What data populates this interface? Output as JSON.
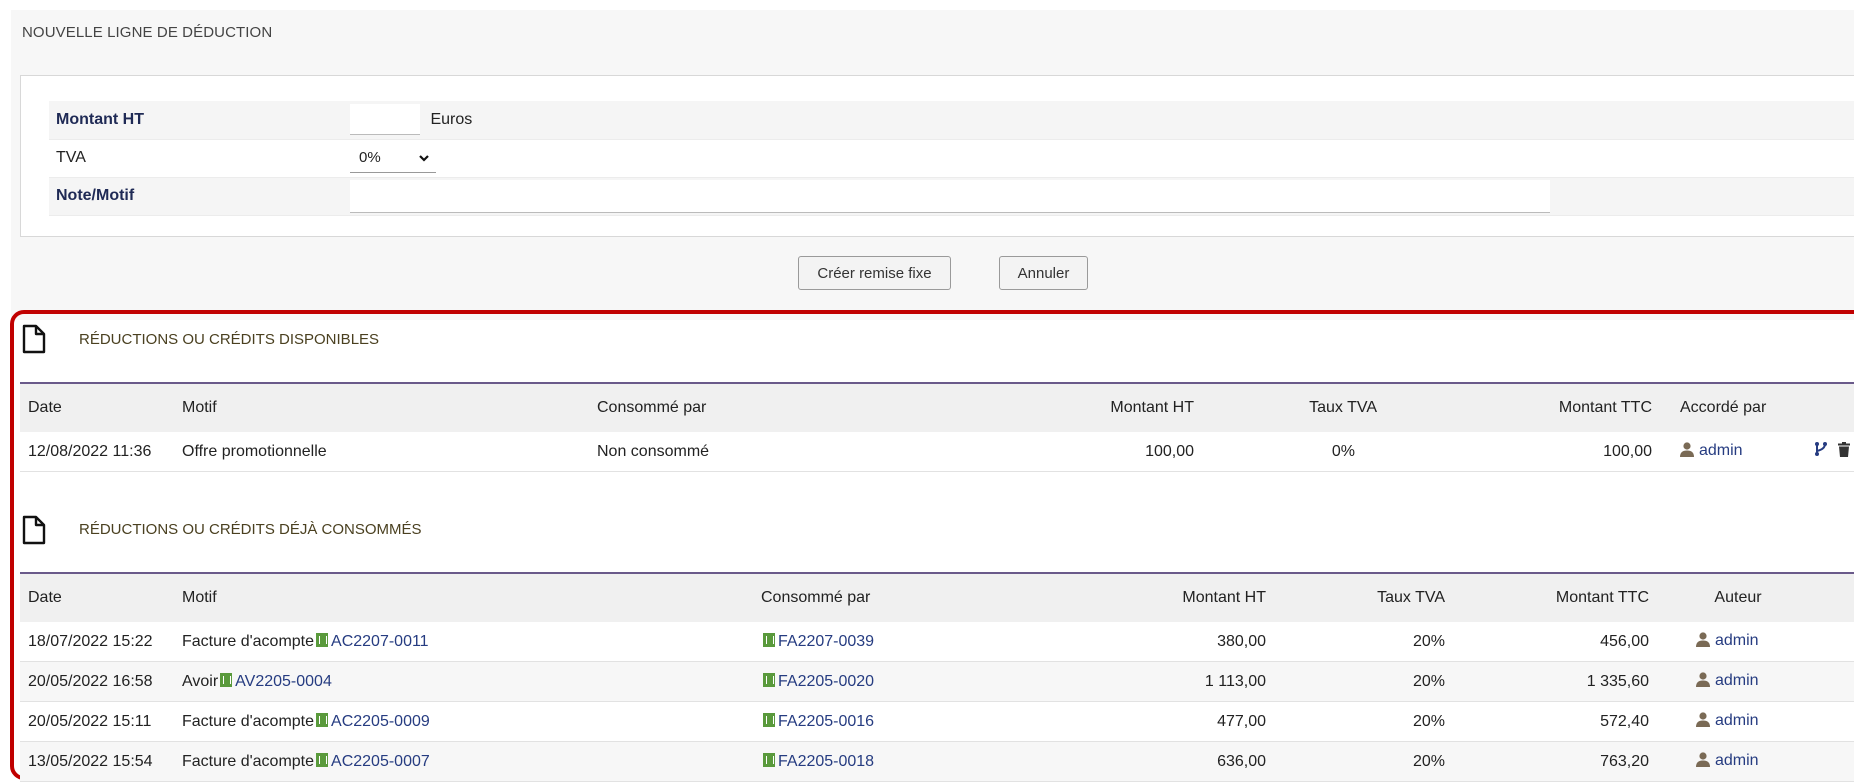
{
  "form": {
    "title": "NOUVELLE LIGNE DE DÉDUCTION",
    "montant_label": "Montant HT",
    "montant_value": "",
    "montant_unit": "Euros",
    "tva_label": "TVA",
    "tva_selected": "0%",
    "note_label": "Note/Motif",
    "note_value": "",
    "create_button": "Créer remise fixe",
    "cancel_button": "Annuler"
  },
  "available": {
    "title": "RÉDUCTIONS OU CRÉDITS DISPONIBLES",
    "headers": [
      "Date",
      "Motif",
      "Consommé par",
      "Montant HT",
      "Taux TVA",
      "Montant TTC",
      "Accordé par"
    ],
    "rows": [
      {
        "date": "12/08/2022 11:36",
        "motif": "Offre promotionnelle",
        "consomme": "Non consommé",
        "ht": "100,00",
        "tva": "0%",
        "ttc": "100,00",
        "user": "admin"
      }
    ]
  },
  "consumed": {
    "title": "RÉDUCTIONS OU CRÉDITS DÉJÀ CONSOMMÉS",
    "headers": [
      "Date",
      "Motif",
      "Consommé par",
      "Montant HT",
      "Taux TVA",
      "Montant TTC",
      "Auteur"
    ],
    "rows": [
      {
        "date": "18/07/2022 15:22",
        "motif": "Facture d'acompte",
        "ref": "AC2207-0011",
        "consomme": "FA2207-0039",
        "ht": "380,00",
        "tva": "20%",
        "ttc": "456,00",
        "user": "admin"
      },
      {
        "date": "20/05/2022 16:58",
        "motif": "Avoir",
        "ref": "AV2205-0004",
        "consomme": "FA2205-0020",
        "ht": "1 113,00",
        "tva": "20%",
        "ttc": "1 335,60",
        "user": "admin"
      },
      {
        "date": "20/05/2022 15:11",
        "motif": "Facture d'acompte",
        "ref": "AC2205-0009",
        "consomme": "FA2205-0016",
        "ht": "477,00",
        "tva": "20%",
        "ttc": "572,40",
        "user": "admin"
      },
      {
        "date": "13/05/2022 15:54",
        "motif": "Facture d'acompte",
        "ref": "AC2205-0007",
        "consomme": "FA2205-0018",
        "ht": "636,00",
        "tva": "20%",
        "ttc": "763,20",
        "user": "admin"
      }
    ]
  },
  "colors": {
    "highlight": "#c00000",
    "link": "#263c81",
    "doc_icon_green": "#5a9a3c"
  },
  "icons": {
    "section": "document-icon",
    "user": "user-icon",
    "split": "split-icon",
    "delete": "trash-icon"
  }
}
